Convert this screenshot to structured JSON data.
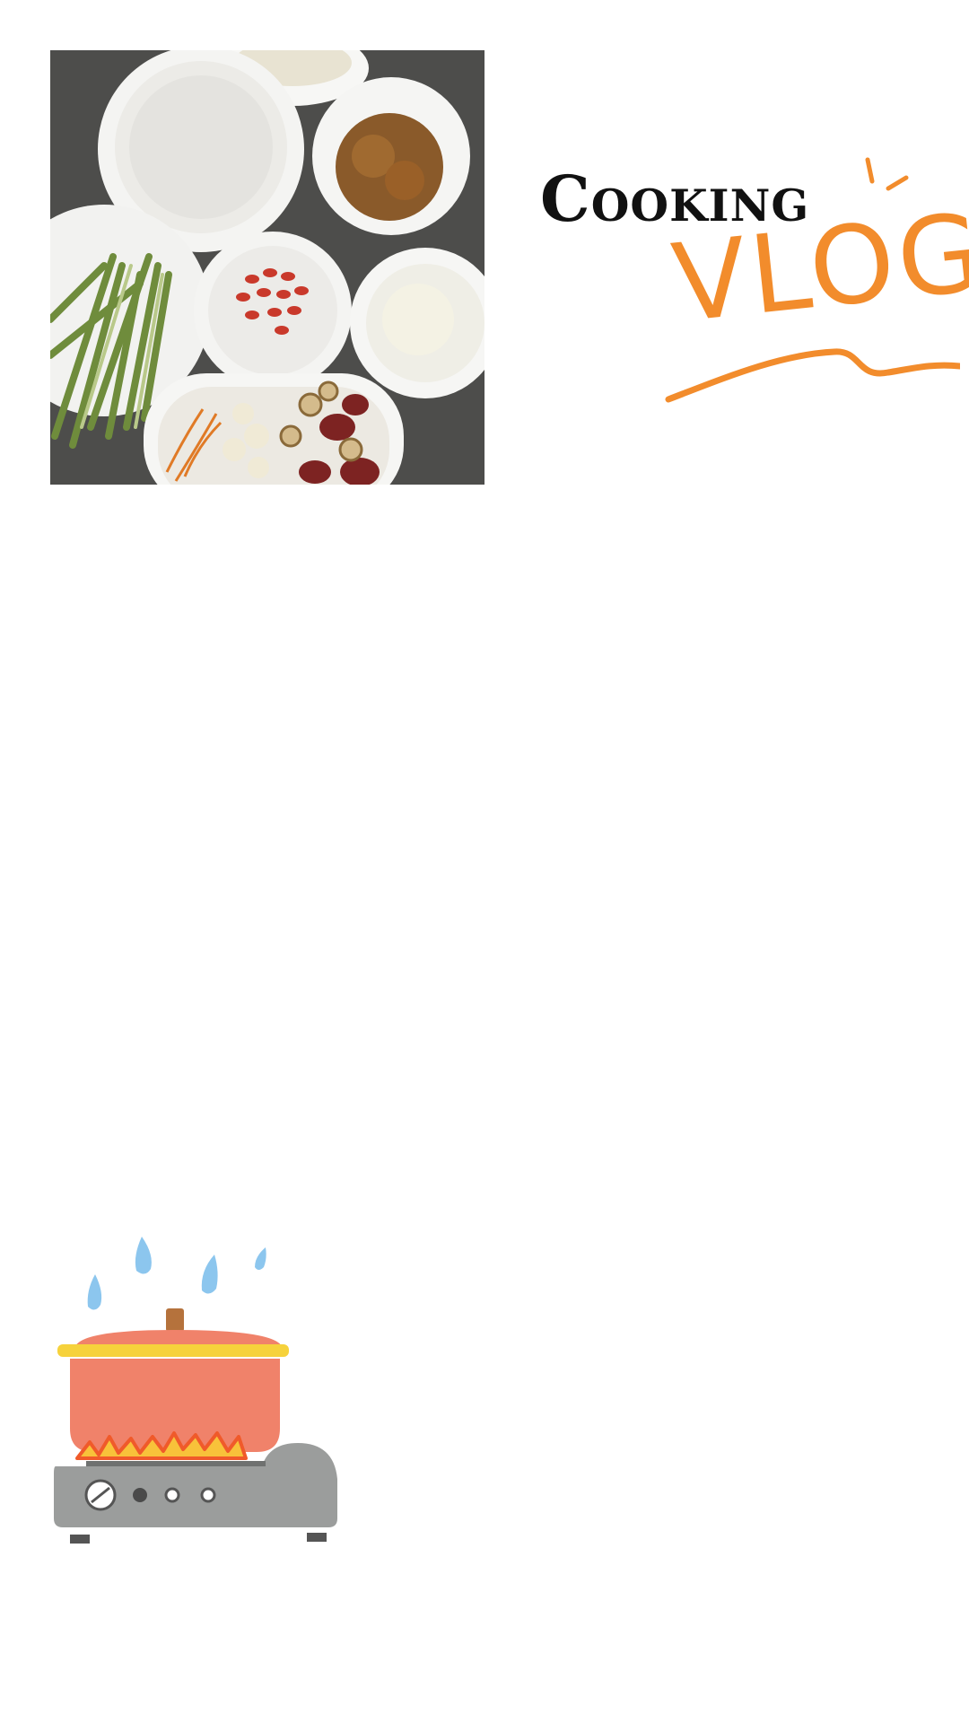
{
  "logo": {
    "line1": "Cooking",
    "line2": "VLOG"
  },
  "colors": {
    "background": "#ffffff",
    "brand_orange": "#f28c2c",
    "pot_red": "#f0826a",
    "lid_yellow": "#f6d23c",
    "stove_gray": "#9b9d9c",
    "steam_blue": "#8cc6ee",
    "table_gray": "#4f4f4d"
  },
  "images": {
    "ingredients_photo": "ingredients-bowls-photo",
    "illustration": "pot-on-stove-illustration"
  }
}
